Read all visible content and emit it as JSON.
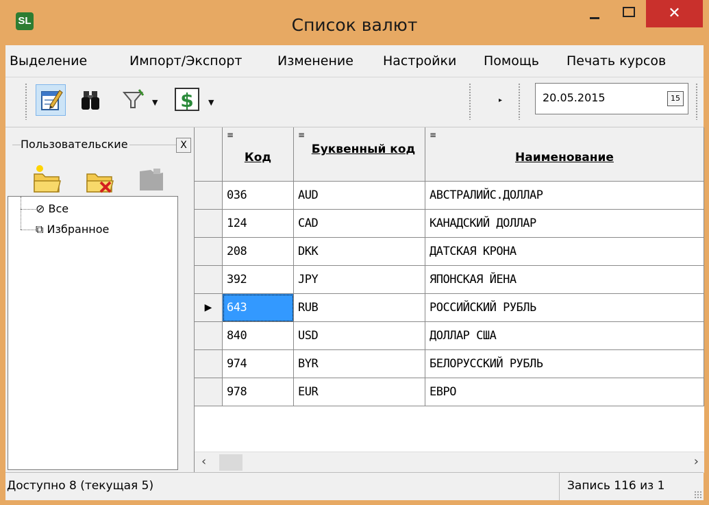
{
  "window": {
    "title": "Список валют",
    "app_icon_glyph": "SL",
    "close_glyph": "✕"
  },
  "menu": [
    "Выделение",
    "Импорт/Экспорт",
    "Изменение",
    "Настройки",
    "Помощь",
    "Печать курсов"
  ],
  "toolbar": {
    "date_value": "20.05.2015",
    "calendar_glyph": "15",
    "icons": [
      "edit-icon",
      "binoculars-icon",
      "filter-icon",
      "dollar-icon"
    ]
  },
  "left_panel": {
    "title": "Пользовательские",
    "close_glyph": "X",
    "tree": [
      {
        "label": "Все",
        "icon": "no-entry-icon"
      },
      {
        "label": "Избранное",
        "icon": "copy-icon"
      }
    ]
  },
  "grid": {
    "columns": [
      {
        "label": "Код"
      },
      {
        "label": "Буквенный код"
      },
      {
        "label": "Наименование"
      }
    ],
    "rows": [
      {
        "code": "036",
        "alpha": "AUD",
        "name": "АВСТРАЛИЙС.ДОЛЛАР"
      },
      {
        "code": "124",
        "alpha": "CAD",
        "name": "КАНАДСКИЙ ДОЛЛАР"
      },
      {
        "code": "208",
        "alpha": "DKK",
        "name": "ДАТСКАЯ КРОНА"
      },
      {
        "code": "392",
        "alpha": "JPY",
        "name": "ЯПОНСКАЯ ЙЕНА"
      },
      {
        "code": "643",
        "alpha": "RUB",
        "name": "РОССИЙСКИЙ РУБЛЬ",
        "current": true
      },
      {
        "code": "840",
        "alpha": "USD",
        "name": "ДОЛЛАР США"
      },
      {
        "code": "974",
        "alpha": "BYR",
        "name": "БЕЛОРУССКИЙ РУБЛЬ"
      },
      {
        "code": "978",
        "alpha": "EUR",
        "name": "ЕВРО"
      }
    ],
    "current_row_marker": "▶"
  },
  "status": {
    "left": "Доступно 8 (текущая 5)",
    "right": "Запись 116 из 1"
  },
  "colors": {
    "title_bar": "#e7a963",
    "close_button": "#c9302c",
    "selection": "#3399ff",
    "panel": "#f0f0f0"
  }
}
